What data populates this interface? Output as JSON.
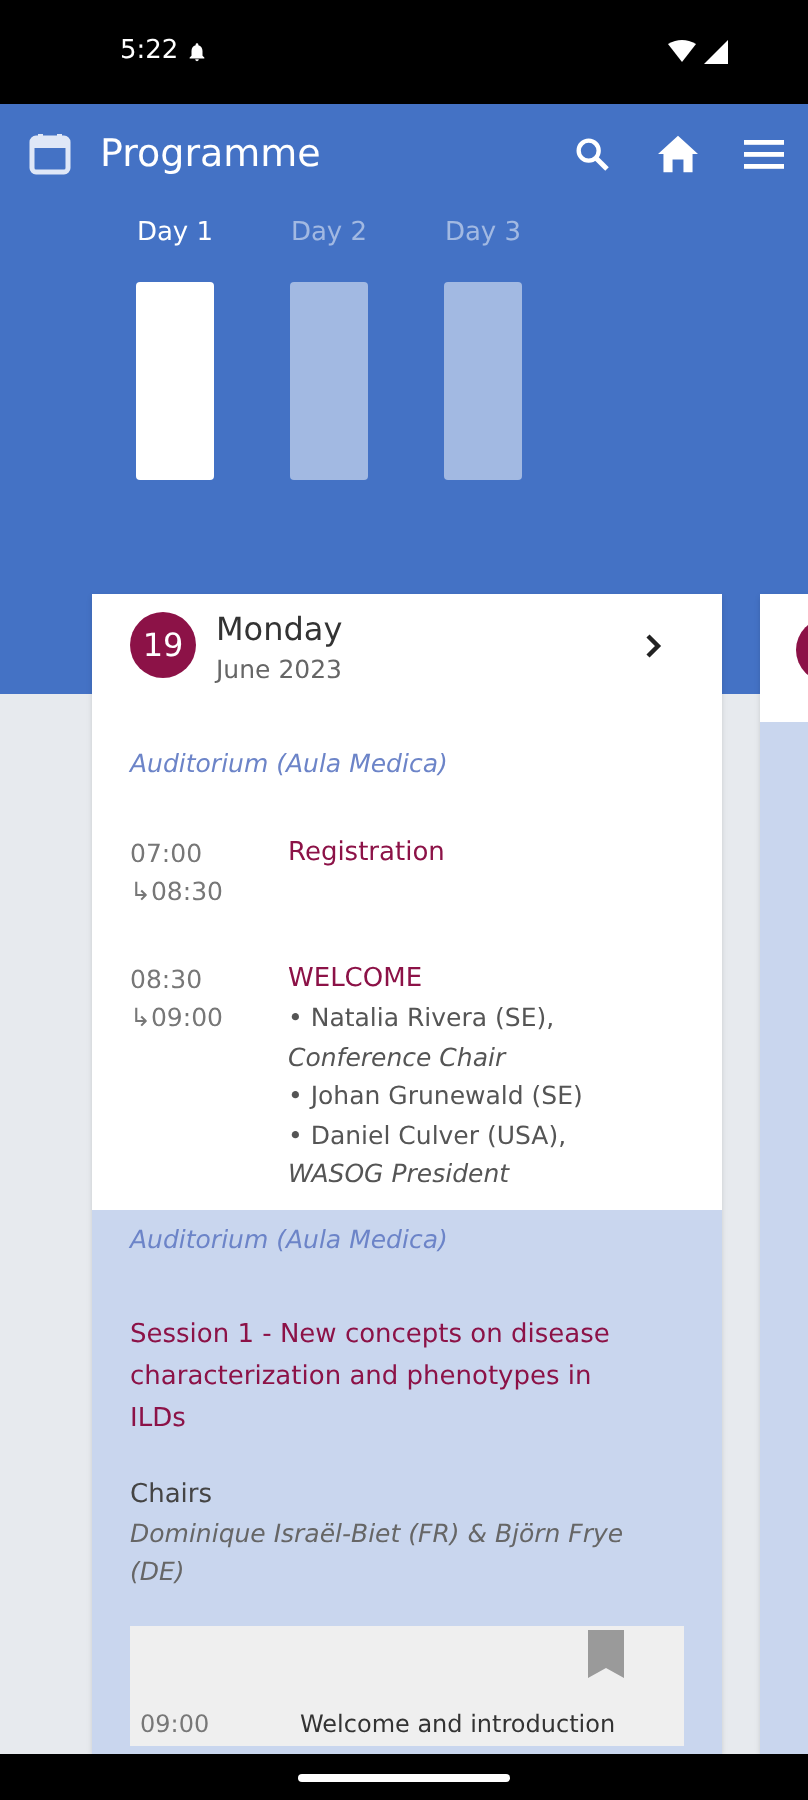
{
  "status_bar": {
    "time": "5:22"
  },
  "app_bar": {
    "title": "Programme"
  },
  "day_tabs": [
    {
      "label": "Day 1",
      "selected": true
    },
    {
      "label": "Day 2",
      "selected": false
    },
    {
      "label": "Day 3",
      "selected": false
    }
  ],
  "day_card": {
    "date": "19",
    "weekday": "Monday",
    "month": "June 2023",
    "sections": [
      {
        "kind": "plain",
        "room": "Auditorium (Aula Medica)",
        "items": [
          {
            "start": "07:00",
            "end": "↳08:30",
            "title": "Registration"
          },
          {
            "start": "08:30",
            "end": "↳09:00",
            "title": "WELCOME",
            "lines": [
              "• Natalia Rivera (SE),",
              "*Conference Chair*",
              "• Johan Grunewald (SE)",
              "• Daniel Culver (USA),",
              "*WASOG President*"
            ]
          }
        ]
      },
      {
        "kind": "session",
        "room": "Auditorium (Aula Medica)",
        "title": "Session 1 - New concepts on disease characterization and phenotypes in ILDs",
        "chairs_label": "Chairs",
        "chairs": "Dominique Israël-Biet (FR) & Björn Frye (DE)",
        "talk": {
          "time": "09:00",
          "title": "Welcome and introduction",
          "bookmarked": false
        }
      }
    ]
  }
}
